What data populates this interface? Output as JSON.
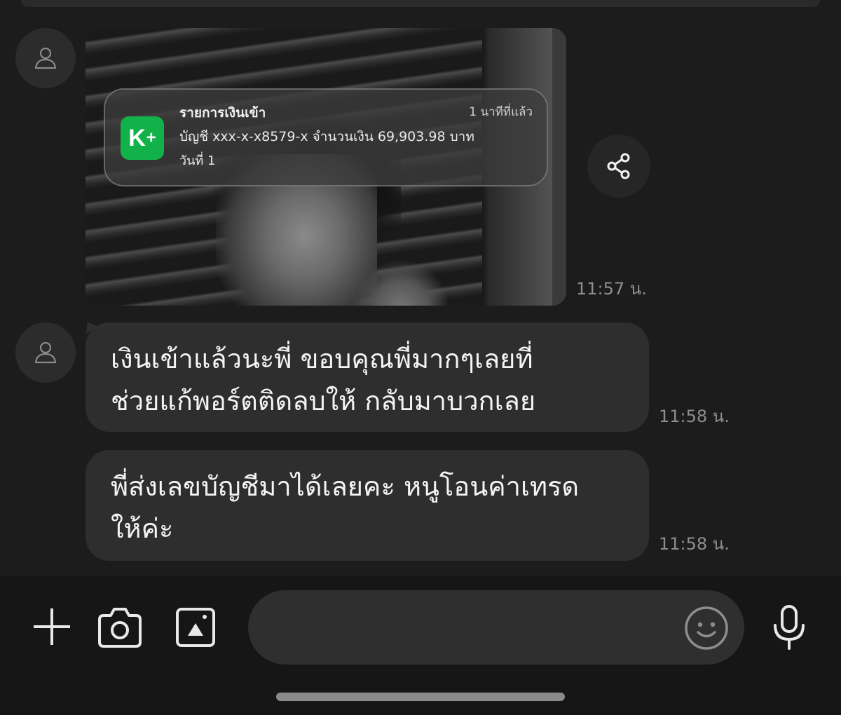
{
  "notification": {
    "app_icon": "K+",
    "title": "รายการเงินเข้า",
    "time": "1 นาทีที่แล้ว",
    "account_line": "บัญชี xxx-x-x8579-x จำนวนเงิน 69,903.98 บาท",
    "date_line": "วันที่ 1"
  },
  "messages": [
    {
      "type": "image",
      "time": "11:57 น."
    },
    {
      "type": "text",
      "line1": "เงินเข้าแล้วนะพี่  ขอบคุณพี่มากๆเลยที่",
      "line2": "ช่วยแก้พอร์ตติดลบให้ กลับมาบวกเลย",
      "time": "11:58 น."
    },
    {
      "type": "text",
      "line1": "พี่ส่งเลขบัญชีมาได้เลยคะ หนูโอนค่าเทรด",
      "line2": "ให้ค่ะ",
      "time": "11:58 น."
    }
  ],
  "input": {
    "placeholder": ""
  },
  "icons": {
    "avatar": "person-icon",
    "share": "share-icon",
    "add": "plus-icon",
    "camera": "camera-icon",
    "gallery": "image-icon",
    "emoji": "emoji-icon",
    "mic": "mic-icon"
  },
  "colors": {
    "background": "#1c1c1c",
    "bubble": "#2e2e2e",
    "kplus_green": "#12b24a",
    "timestamp": "#8e8e8e"
  }
}
